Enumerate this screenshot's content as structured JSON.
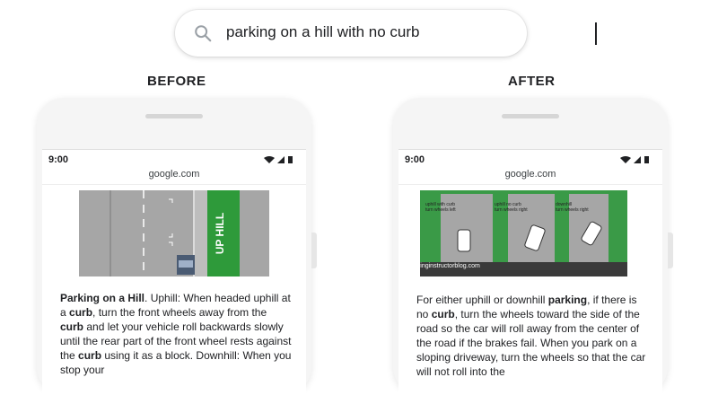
{
  "search": {
    "query": "parking on a hill with no curb",
    "icon": "search-icon"
  },
  "labels": {
    "before": "BEFORE",
    "after": "AFTER"
  },
  "phones": [
    {
      "time": "9:00",
      "url": "google.com",
      "image_text": "UP HILL",
      "text_parts": [
        {
          "b": true,
          "t": "Parking on a Hill"
        },
        {
          "b": false,
          "t": ". Uphill: When headed uphill at a "
        },
        {
          "b": true,
          "t": "curb"
        },
        {
          "b": false,
          "t": ", turn the front wheels away from the "
        },
        {
          "b": true,
          "t": "curb"
        },
        {
          "b": false,
          "t": " and let your vehicle roll backwards slowly until the rear part of the front wheel rests against the "
        },
        {
          "b": true,
          "t": "curb"
        },
        {
          "b": false,
          "t": " using it as a block. Downhill: When you stop your"
        }
      ]
    },
    {
      "time": "9:00",
      "url": "google.com",
      "image_captions": [
        "uphill with curb\nturn wheels left",
        "uphill no curb\nturn wheels right",
        "downhill\nturn wheels right"
      ],
      "image_source": "drivinginstructorblog.com",
      "text_parts": [
        {
          "b": false,
          "t": "For either uphill or downhill "
        },
        {
          "b": true,
          "t": "parking"
        },
        {
          "b": false,
          "t": ", if there is no "
        },
        {
          "b": true,
          "t": "curb"
        },
        {
          "b": false,
          "t": ", turn the wheels toward the side of the road so the car will roll away from the center of the road if the brakes fail. When you park on a sloping driveway, turn the wheels so that the car will not roll into the"
        }
      ]
    }
  ]
}
